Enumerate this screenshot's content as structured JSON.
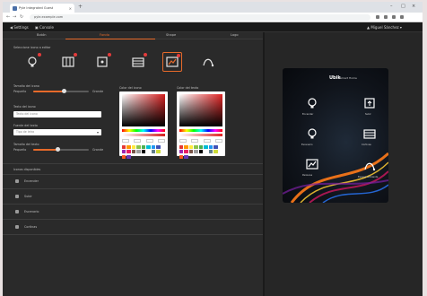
{
  "browser": {
    "tab_title": "Pyle Integrated Guest",
    "url": "pyle.example.com",
    "window_controls": [
      "–",
      "□",
      "×"
    ]
  },
  "app_header": {
    "left_items": [
      "◀ Settings",
      "▣ Console"
    ],
    "user": "▲ Miguel Sánchez ▾"
  },
  "section_tabs": [
    {
      "label": "Botón",
      "active": false
    },
    {
      "label": "Fondo",
      "active": true
    },
    {
      "label": "Shape",
      "active": false
    },
    {
      "label": "Logo",
      "active": false
    }
  ],
  "icon_picker": {
    "label": "Seleccione icono a editar",
    "icons": [
      "lamp-icon",
      "curtains-icon",
      "window-blind-icon",
      "heater-icon",
      "scene-icon",
      "curve-icon"
    ],
    "selected": 4
  },
  "controls": {
    "size_label": "Tamaño del icono",
    "size_min": "Pequeño",
    "size_max": "Grande",
    "size_value": 0.55,
    "text_label": "Texto del icono",
    "text_placeholder": "Texto del icono",
    "font_label": "Fuente del texto",
    "font_value": "Tipo de letra",
    "textsize_label": "Tamaño del texto",
    "textsize_min": "Pequeño",
    "textsize_max": "Grande",
    "textsize_value": 0.45
  },
  "pickers": [
    {
      "label": "Color del icono"
    },
    {
      "label": "Color del texto"
    }
  ],
  "preset_colors": [
    "#e53935",
    "#ff9800",
    "#ffeb3b",
    "#8bc34a",
    "#4caf50",
    "#00bcd4",
    "#2196f3",
    "#3f51b5",
    "#9c27b0",
    "#e91e63",
    "#795548",
    "#9e9e9e",
    "#000000",
    "#ffffff",
    "#607d8b",
    "#cddc39",
    "#ff5722",
    "#673ab7"
  ],
  "icons_section": {
    "title": "Iconos disponibles",
    "items": [
      "Encender",
      "Subir",
      "Escenario",
      "Cortinas"
    ]
  },
  "preview": {
    "logo": "Ubik",
    "subtitle": "Smart Home",
    "captions": [
      "Encender",
      "Subir",
      "Escenario",
      "Cortinas",
      "Persiana",
      "Escena ambiente"
    ]
  }
}
